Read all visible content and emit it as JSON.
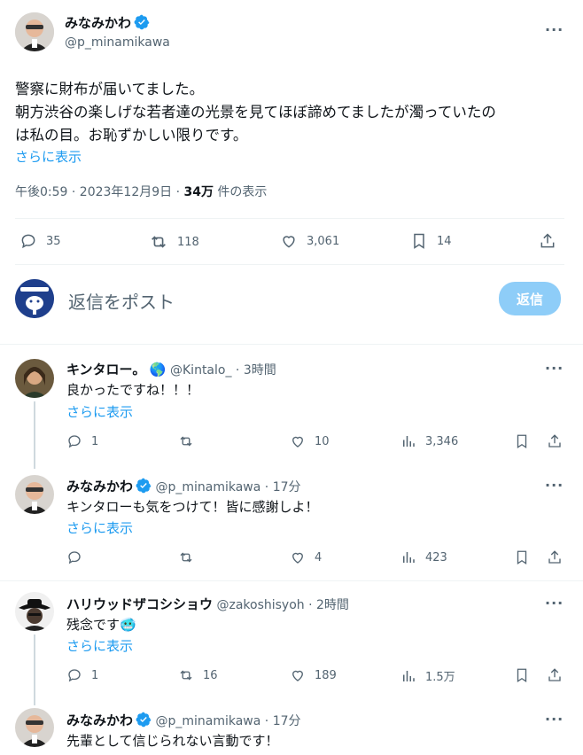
{
  "colors": {
    "accent": "#1d9bf0",
    "verified": "#1d9bf0",
    "muted": "#536471"
  },
  "main_post": {
    "name": "みなみかわ",
    "handle": "@p_minamikawa",
    "lines": [
      "警察に財布が届いてました。",
      "朝方渋谷の楽しげな若者達の光景を見てほぼ諦めてましたが濁っていたの",
      "は私の目。お恥ずかしい限りです。"
    ],
    "show_more": "さらに表示",
    "meta_time": "午後0:59 · 2023年12月9日 · ",
    "meta_views": "34万",
    "meta_views_suffix": " 件の表示",
    "replies": "35",
    "reposts": "118",
    "likes": "3,061",
    "bookmarks": "14"
  },
  "composer": {
    "placeholder": "返信をポスト",
    "button": "返信"
  },
  "replies": [
    {
      "name": "キンタロー。",
      "emoji": "🌎",
      "handle": "@Kintalo_",
      "time": "· 3時間",
      "text": "良かったですね！！！",
      "show_more": "さらに表示",
      "replies": "1",
      "reposts": "",
      "likes": "10",
      "views": "3,346"
    },
    {
      "name": "みなみかわ",
      "handle": "@p_minamikawa",
      "time": "· 17分",
      "text": "キンタローも気をつけて！皆に感謝しよ！",
      "show_more": "さらに表示",
      "replies": "",
      "reposts": "",
      "likes": "4",
      "views": "423"
    },
    {
      "name": "ハリウッドザコシショウ",
      "handle": "@zakoshisyoh",
      "time": "· 2時間",
      "text": "残念です",
      "emoji": "🥶",
      "show_more": "さらに表示",
      "replies": "1",
      "reposts": "16",
      "likes": "189",
      "views": "1.5万"
    },
    {
      "name": "みなみかわ",
      "handle": "@p_minamikawa",
      "time": "· 17分",
      "text": "先輩として信じられない言動です！"
    }
  ]
}
